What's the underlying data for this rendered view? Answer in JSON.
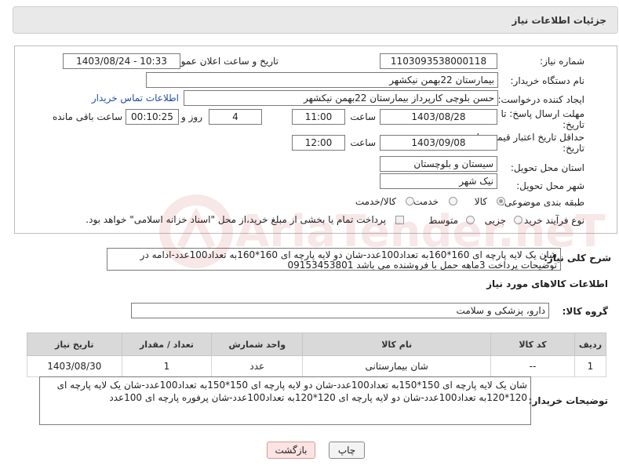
{
  "page": {
    "title": "جزئیات اطلاعات نیاز"
  },
  "form": {
    "need_number_label": "شماره نیاز:",
    "need_number_value": "1103093538000118",
    "announce_label": "تاریخ و ساعت اعلان عمومی:",
    "announce_value": "1403/08/24 - 10:33",
    "buyer_org_label": "نام دستگاه خریدار:",
    "buyer_org_value": "بیمارستان 22بهمن نیکشهر",
    "requester_label": "ایجاد کننده درخواست:",
    "requester_value": "حسن بلوچی کارپرداز  بیمارستان 22بهمن نیکشهر",
    "buyer_contact_link": "اطلاعات تماس خریدار",
    "reply_deadline_label_1": "مهلت ارسال پاسخ: تا",
    "reply_deadline_label_2": "تاریخ:",
    "reply_date": "1403/08/28",
    "time_label": "ساعت",
    "reply_time": "11:00",
    "days_value": "4",
    "days_label": "روز و",
    "remaining_value": "00:10:25",
    "remaining_label": "ساعت باقی مانده",
    "price_validity_label_1": "حداقل تاریخ اعتبار قیمت: تا",
    "price_validity_label_2": "تاریخ:",
    "validity_date": "1403/09/08",
    "validity_time": "12:00",
    "province_label": "استان محل تحویل:",
    "province_value": "سیستان و بلوچستان",
    "city_label": "شهر محل تحویل:",
    "city_value": "نیک شهر",
    "category_label": "طبقه بندی موضوعی:",
    "category_options": [
      "کالا",
      "خدمت",
      "کالا/خدمت"
    ],
    "category_selected": "کالا",
    "process_label": "نوع فرآیند خرید :",
    "process_options": [
      "جزیی",
      "متوسط"
    ],
    "payment_note": "پرداخت تمام یا بخشی از مبلغ خرید،از محل \"اسناد خزانه اسلامی\" خواهد بود."
  },
  "description": {
    "label": "شرح کلی نیاز:",
    "text": "شان یک لایه پارچه ای 160*160به تعداد100عدد-شان دو لایه پارچه ای 160*160به تعداد100عدد-ادامه در توضیحات پرداخت 3ماهه حمل با فروشنده می باشد 09153453801"
  },
  "goods_info": {
    "title": "اطلاعات کالاهای مورد نیاز",
    "group_label": "گروه کالا:",
    "group_value": "دارو، پزشکی و سلامت"
  },
  "table": {
    "headers": [
      "ردیف",
      "کد کالا",
      "نام کالا",
      "واحد شمارش",
      "تعداد / مقدار",
      "تاریخ نیاز"
    ],
    "rows": [
      [
        "1",
        "--",
        "شان بیمارستانی",
        "عدد",
        "1",
        "1403/08/30"
      ]
    ]
  },
  "buyer_notes": {
    "label": "توضیحات خریدار:",
    "text": "شان یک لایه پارچه ای 150*150به تعداد100عدد-شان دو لایه پارچه ای 150*150به تعداد100عدد-شان یک لایه پارچه ای 120*120به تعداد100عدد-شان دو لایه پارچه ای 120*120به تعداد100عدد-شان پرفوره پارچه ای 100عدد"
  },
  "buttons": {
    "print": "چاپ",
    "back": "بازگشت"
  },
  "watermark": {
    "text": "AriaTender.neT"
  },
  "colors": {
    "link": "#1f4ea8",
    "header_bg": "#e9e9e9",
    "table_header_bg": "#d9d9d9",
    "back_button_bg": "#fde3e3"
  }
}
